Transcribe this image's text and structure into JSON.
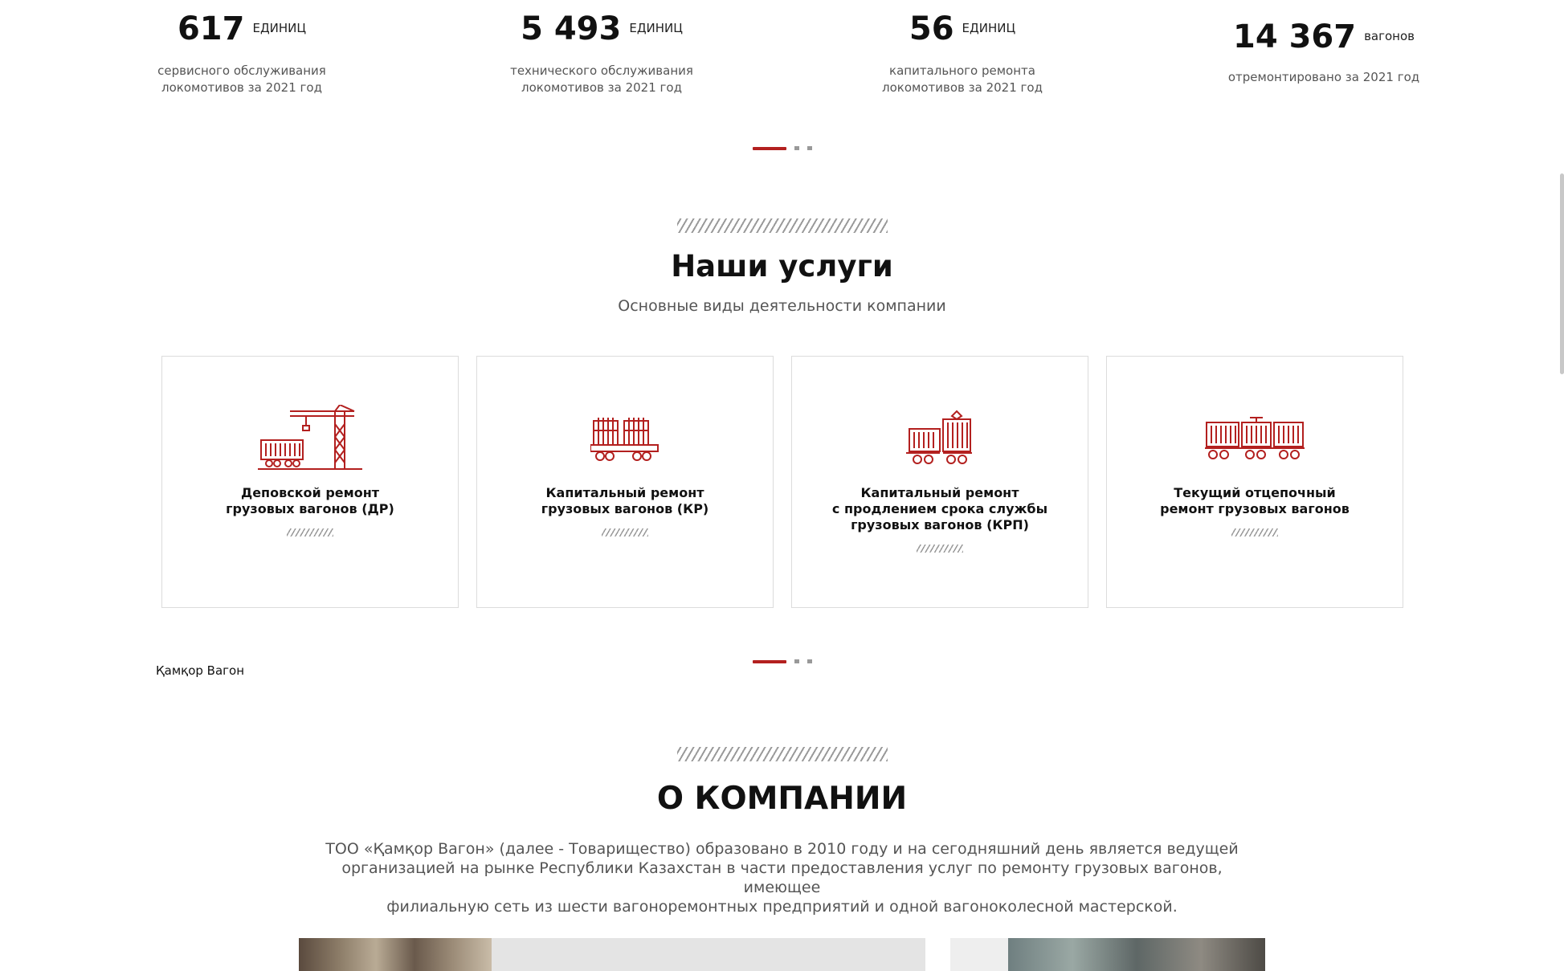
{
  "stats": [
    {
      "number": "617",
      "unit": "ЕДИНИЦ",
      "desc_line1": "сервисного обслуживания",
      "desc_line2": "локомотивов за 2021 год"
    },
    {
      "number": "5 493",
      "unit": "ЕДИНИЦ",
      "desc_line1": "технического обслуживания",
      "desc_line2": "локомотивов за 2021 год"
    },
    {
      "number": "56",
      "unit": "ЕДИНИЦ",
      "desc_line1": "капитального ремонта",
      "desc_line2": "локомотивов за 2021 год"
    },
    {
      "number": "14 367",
      "unit": "вагонов",
      "desc_line1": "отремонтировано за 2021 год",
      "desc_line2": ""
    }
  ],
  "services": {
    "title": "Наши услуги",
    "subtitle": "Основные виды деятельности компании",
    "cards": [
      {
        "line1": "Деповской ремонт",
        "line2": "грузовых вагонов (ДР)",
        "line3": "",
        "icon": "crane-wagon-icon"
      },
      {
        "line1": "Капитальный ремонт",
        "line2": "грузовых вагонов (КР)",
        "line3": "",
        "icon": "flatcar-wagon-icon"
      },
      {
        "line1": "Капитальный ремонт",
        "line2": "с продлением срока службы",
        "line3": "грузовых вагонов (КРП)",
        "icon": "lifted-wagon-icon"
      },
      {
        "line1": "Текущий отцепочный",
        "line2": "ремонт грузовых вагонов",
        "line3": "",
        "icon": "tank-wagons-icon"
      }
    ]
  },
  "brand_label": "Қамқор Вагон",
  "about": {
    "title": "О КОМПАНИИ",
    "text_line1": "ТОО «Қамқор Вагон» (далее - Товарищество) образовано в 2010 году и на сегодняшний день является ведущей",
    "text_line2": "организацией на рынке Республики Казахстан в части предоставления услуг по ремонту грузовых вагонов, имеющее",
    "text_line3": "филиальную сеть из шести вагоноремонтных предприятий и одной вагоноколесной мастерской."
  },
  "colors": {
    "accent": "#b3201f",
    "text": "#111111",
    "muted": "#555555"
  }
}
